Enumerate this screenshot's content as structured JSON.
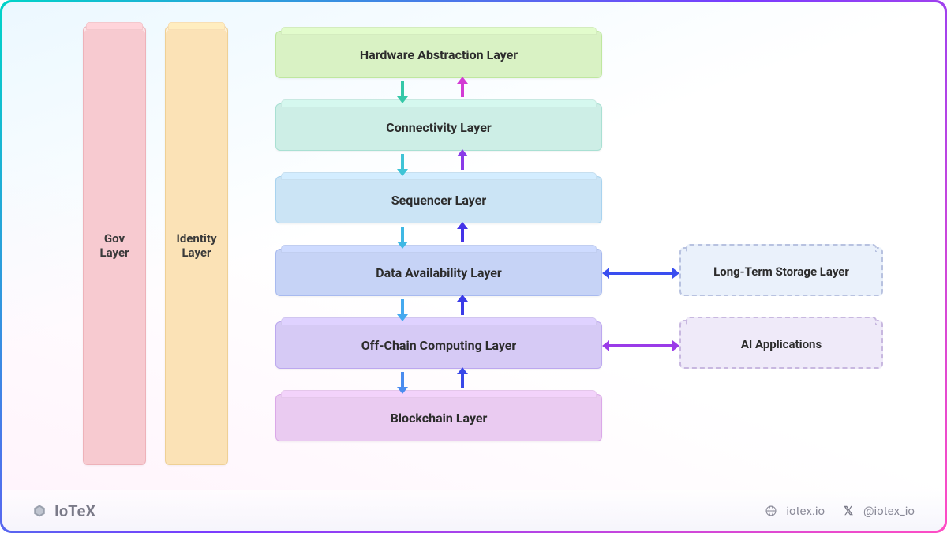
{
  "pillars": {
    "gov": "Gov\nLayer",
    "identity": "Identity\nLayer"
  },
  "layers": {
    "hal": "Hardware Abstraction Layer",
    "conn": "Connectivity Layer",
    "seq": "Sequencer Layer",
    "da": "Data Availability Layer",
    "occ": "Off-Chain Computing Layer",
    "bc": "Blockchain Layer"
  },
  "side": {
    "storage": "Long-Term Storage Layer",
    "ai": "AI Applications"
  },
  "arrows": {
    "down_colors": [
      "#35c8a8",
      "#3fc4d6",
      "#3fb8e4",
      "#45a9ef",
      "#4a8cef"
    ],
    "up_colors": [
      "#d33bd4",
      "#8a3be8",
      "#4433e8",
      "#3a3be8",
      "#3848e8"
    ],
    "side1_color": "#3a4ef0",
    "side2_color": "#9a3be8"
  },
  "footer": {
    "brand": "IoTeX",
    "site": "iotex.io",
    "handle": "@iotex_io"
  }
}
